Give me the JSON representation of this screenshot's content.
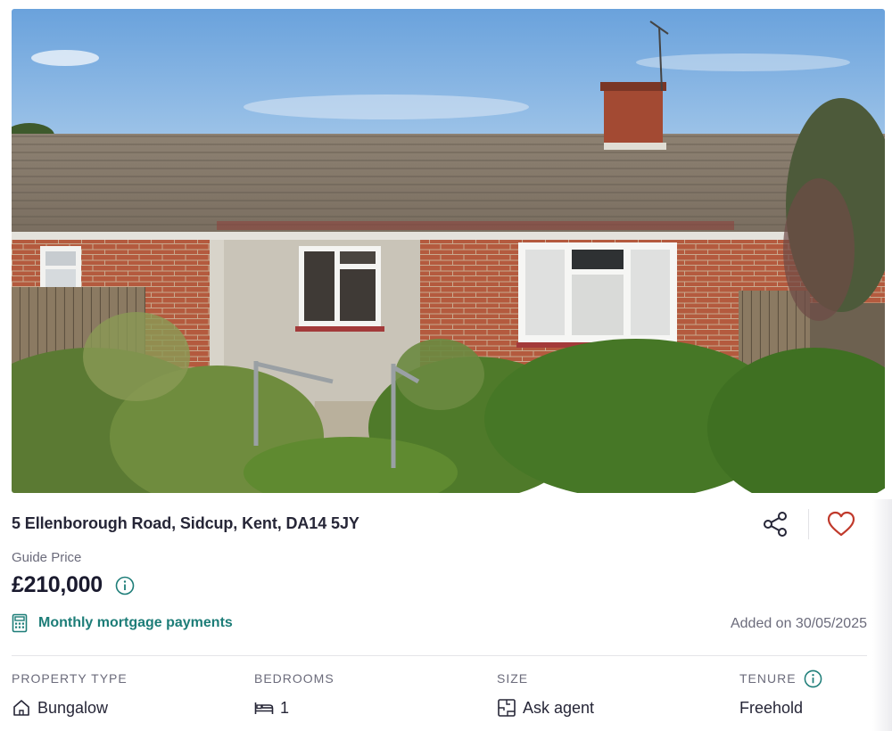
{
  "listing": {
    "photo_alt": "5 Ellenborough Road, Sidcup, Kent, DA14 5JY",
    "address": "5 Ellenborough Road, Sidcup, Kent, DA14 5JY",
    "price_qualifier": "Guide Price",
    "price": "£210,000",
    "mortgage_link": "Monthly mortgage payments",
    "added": "Added on 30/05/2025"
  },
  "actions": {
    "share_icon": "share-icon",
    "save_icon": "heart-icon"
  },
  "features": [
    {
      "label": "PROPERTY TYPE",
      "value": "Bungalow",
      "icon": "house-icon"
    },
    {
      "label": "BEDROOMS",
      "value": "1",
      "icon": "bed-icon"
    },
    {
      "label": "SIZE",
      "value": "Ask agent",
      "icon": "floorplan-icon"
    },
    {
      "label": "TENURE",
      "value": "Freehold",
      "icon": "info-icon"
    }
  ],
  "colors": {
    "teal": "#1d7d78",
    "heart": "#c0392b",
    "text": "#262637",
    "muted": "#6b6b7b"
  }
}
